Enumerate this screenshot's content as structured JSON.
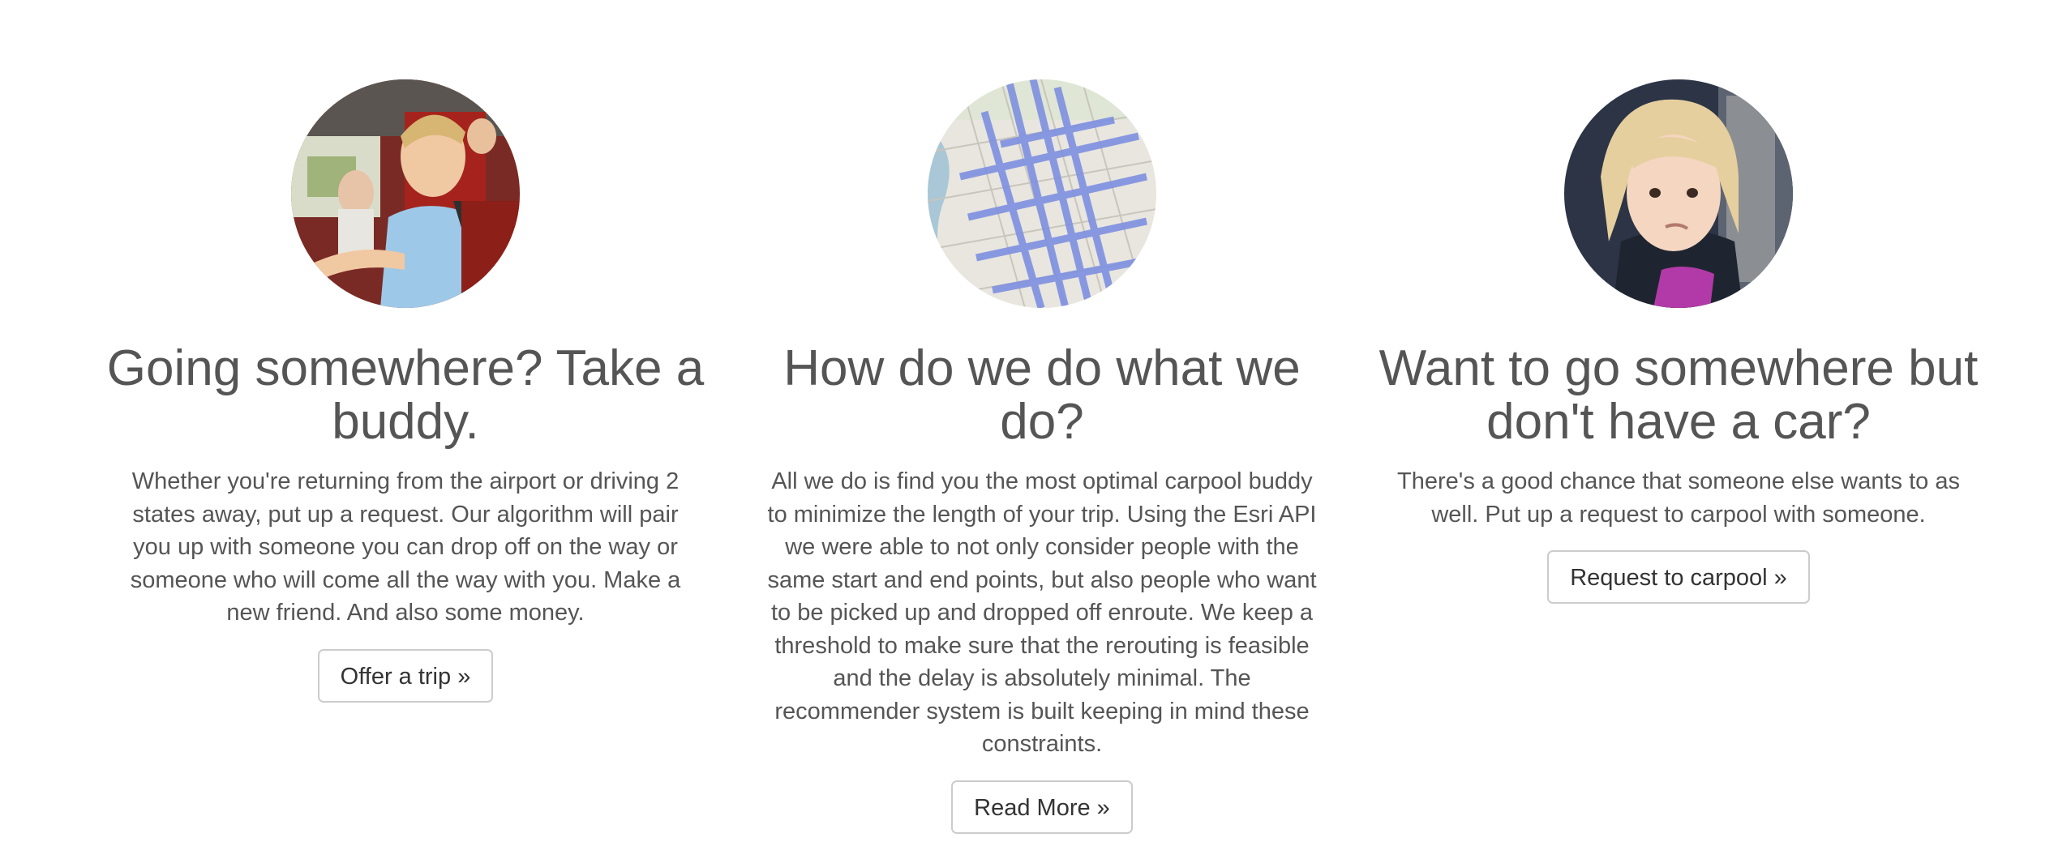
{
  "features": [
    {
      "image_icon": "people-in-car-photo",
      "heading": "Going somewhere? Take a buddy.",
      "description": "Whether you're returning from the airport or driving 2 states away, put up a request. Our algorithm will pair you up with someone you can drop off on the way or someone who will come all the way with you. Make a new friend. And also some money.",
      "button_label": "Offer a trip »"
    },
    {
      "image_icon": "city-map-photo",
      "heading": "How do we do what we do?",
      "description": "All we do is find you the most optimal carpool buddy to minimize the length of your trip. Using the Esri API we were able to not only consider people with the same start and end points, but also people who want to be picked up and dropped off enroute. We keep a threshold to make sure that the rerouting is feasible and the delay is absolutely minimal. The recommender system is built keeping in mind these constraints.",
      "button_label": "Read More »"
    },
    {
      "image_icon": "child-in-car-seat-photo",
      "heading": "Want to go somewhere but don't have a car?",
      "description": "There's a good chance that someone else wants to as well. Put up a request to carpool with someone.",
      "button_label": "Request to carpool »"
    }
  ],
  "colors": {
    "text": "#555555",
    "button_text": "#333333",
    "button_border": "#cccccc",
    "background": "#ffffff"
  }
}
